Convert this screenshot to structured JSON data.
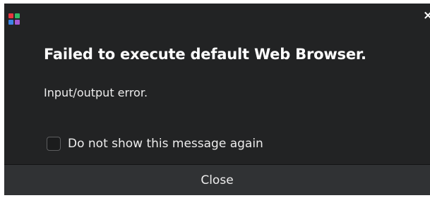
{
  "dialog": {
    "app_icon": "app-grid-icon",
    "close_glyph": "×",
    "title": "Failed to execute default Web Browser.",
    "message": "Input/output error.",
    "checkbox": {
      "label": "Do not show this message again",
      "checked": false
    },
    "close_button_label": "Close"
  },
  "colors": {
    "dialog_bg": "#222324",
    "footer_bg": "#303234",
    "text": "#ffffff",
    "icon_red": "#e8353f",
    "icon_green": "#31b867",
    "icon_blue": "#3d85e6",
    "icon_purple": "#a45ad4"
  }
}
